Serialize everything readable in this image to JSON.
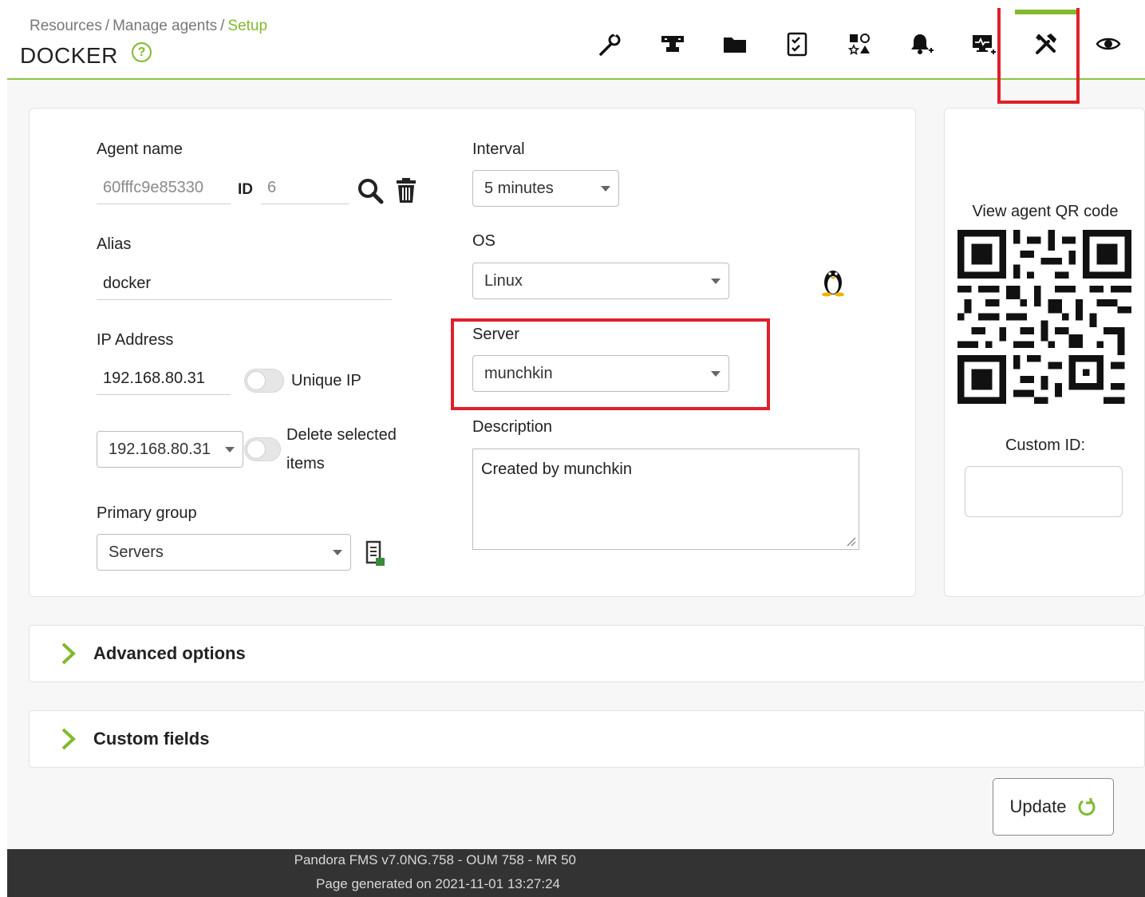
{
  "header": {
    "breadcrumb": {
      "item1": "Resources",
      "sep1": "/",
      "item2": "Manage agents",
      "sep2": "/",
      "current": "Setup"
    },
    "title": "DOCKER",
    "help_symbol": "?"
  },
  "tabs": [
    {
      "name": "manage-icon"
    },
    {
      "name": "network-icon"
    },
    {
      "name": "folder-icon"
    },
    {
      "name": "checklist-icon"
    },
    {
      "name": "shapes-icon"
    },
    {
      "name": "bell-plus-icon"
    },
    {
      "name": "monitor-plus-icon"
    },
    {
      "name": "tools-icon",
      "active": true
    },
    {
      "name": "eye-icon"
    }
  ],
  "form": {
    "agent_name": {
      "label": "Agent name",
      "value": "60fffc9e85330"
    },
    "id": {
      "label": "ID",
      "value": "6"
    },
    "alias": {
      "label": "Alias",
      "value": "docker"
    },
    "ip_address": {
      "label": "IP Address",
      "value": "192.168.80.31",
      "unique_label": "Unique IP"
    },
    "ip_select": {
      "value": "192.168.80.31",
      "delete_label_1": "Delete selected",
      "delete_label_2": "items"
    },
    "primary_group": {
      "label": "Primary group",
      "value": "Servers"
    },
    "interval": {
      "label": "Interval",
      "value": "5 minutes"
    },
    "os": {
      "label": "OS",
      "value": "Linux"
    },
    "server": {
      "label": "Server",
      "value": "munchkin"
    },
    "description": {
      "label": "Description",
      "value": "Created by munchkin"
    }
  },
  "qr": {
    "title": "View agent QR code",
    "custom_id_label": "Custom ID:",
    "custom_id_value": ""
  },
  "sections": {
    "advanced": "Advanced options",
    "custom_fields": "Custom fields"
  },
  "actions": {
    "update": "Update"
  },
  "footer": {
    "version": "Pandora FMS v7.0NG.758 - OUM 758 - MR 50",
    "generated": "Page generated on 2021-11-01 13:27:24"
  },
  "colors": {
    "accent": "#82b92e",
    "highlight": "#e0202a",
    "footer_bg": "#333333"
  }
}
